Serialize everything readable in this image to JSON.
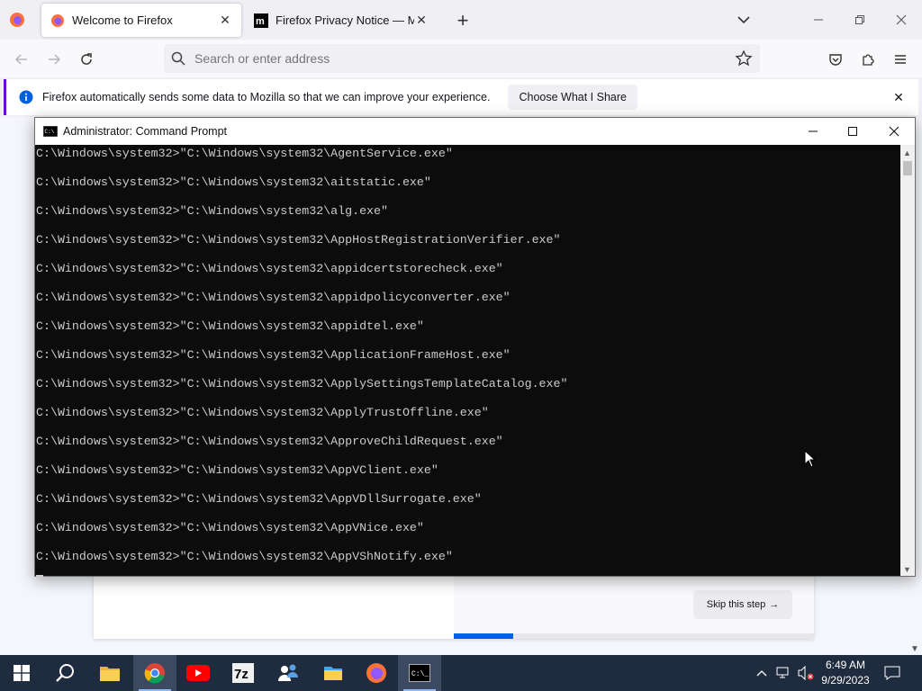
{
  "browser": {
    "tabs": [
      {
        "title": "Welcome to Firefox",
        "active": true
      },
      {
        "title": "Firefox Privacy Notice — Mozill",
        "active": false
      }
    ],
    "urlbar": {
      "placeholder": "Search or enter address"
    },
    "notification": {
      "message": "Firefox automatically sends some data to Mozilla so that we can improve your experience.",
      "button": "Choose What I Share"
    },
    "page": {
      "skip_button": "Skip this step",
      "skip_arrow": "→",
      "progress_fraction": 0.165
    }
  },
  "cmd_window": {
    "title": "Administrator: Command Prompt",
    "lines": [
      "C:\\Windows\\system32>\"C:\\Windows\\system32\\AgentService.exe\"",
      "C:\\Windows\\system32>\"C:\\Windows\\system32\\aitstatic.exe\"",
      "C:\\Windows\\system32>\"C:\\Windows\\system32\\alg.exe\"",
      "C:\\Windows\\system32>\"C:\\Windows\\system32\\AppHostRegistrationVerifier.exe\"",
      "C:\\Windows\\system32>\"C:\\Windows\\system32\\appidcertstorecheck.exe\"",
      "C:\\Windows\\system32>\"C:\\Windows\\system32\\appidpolicyconverter.exe\"",
      "C:\\Windows\\system32>\"C:\\Windows\\system32\\appidtel.exe\"",
      "C:\\Windows\\system32>\"C:\\Windows\\system32\\ApplicationFrameHost.exe\"",
      "C:\\Windows\\system32>\"C:\\Windows\\system32\\ApplySettingsTemplateCatalog.exe\"",
      "C:\\Windows\\system32>\"C:\\Windows\\system32\\ApplyTrustOffline.exe\"",
      "C:\\Windows\\system32>\"C:\\Windows\\system32\\ApproveChildRequest.exe\"",
      "C:\\Windows\\system32>\"C:\\Windows\\system32\\AppVClient.exe\"",
      "C:\\Windows\\system32>\"C:\\Windows\\system32\\AppVDllSurrogate.exe\"",
      "C:\\Windows\\system32>\"C:\\Windows\\system32\\AppVNice.exe\"",
      "C:\\Windows\\system32>\"C:\\Windows\\system32\\AppVShNotify.exe\""
    ]
  },
  "taskbar": {
    "items": [
      "start",
      "search",
      "file-explorer",
      "chrome",
      "youtube",
      "7zip",
      "people",
      "files-app",
      "firefox",
      "command-prompt"
    ],
    "clock": {
      "time": "6:49 AM",
      "date": "9/29/2023"
    }
  },
  "colors": {
    "accent": "#6f0bd7",
    "progress": "#0061e0",
    "console_bg": "#0c0c0c",
    "console_fg": "#cccccc",
    "taskbar": "#1f2b3e"
  }
}
